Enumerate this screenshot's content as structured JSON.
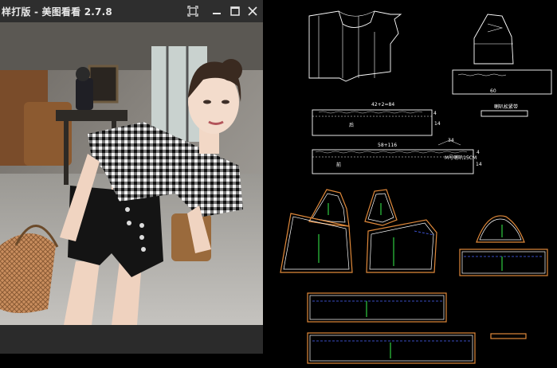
{
  "window": {
    "title": "样打版 - 美图看看 2.7.8"
  },
  "icons": {
    "fit": "fit-screen-icon",
    "minimize": "minimize-icon",
    "maximize": "maximize-icon",
    "close": "close-icon"
  },
  "cad": {
    "piece1_dim": "42+2=84",
    "piece1_text": "后",
    "piece1_height": "14",
    "piece1_side": "4",
    "piece2_dim": "58+116",
    "piece2_text": "前",
    "piece2_note": "M号喇叭15CM",
    "piece2_height": "14",
    "piece2_side": "4",
    "piece2_top": "34",
    "top_right_box": "60",
    "small_label": "喇叭松紧带"
  },
  "colors": {
    "cad_line": "#ffffff",
    "cad_orange": "#e0893a",
    "cad_green": "#2ecc40",
    "cad_blue": "#4a64ff",
    "titlebar_bg": "#2e2e2e"
  }
}
